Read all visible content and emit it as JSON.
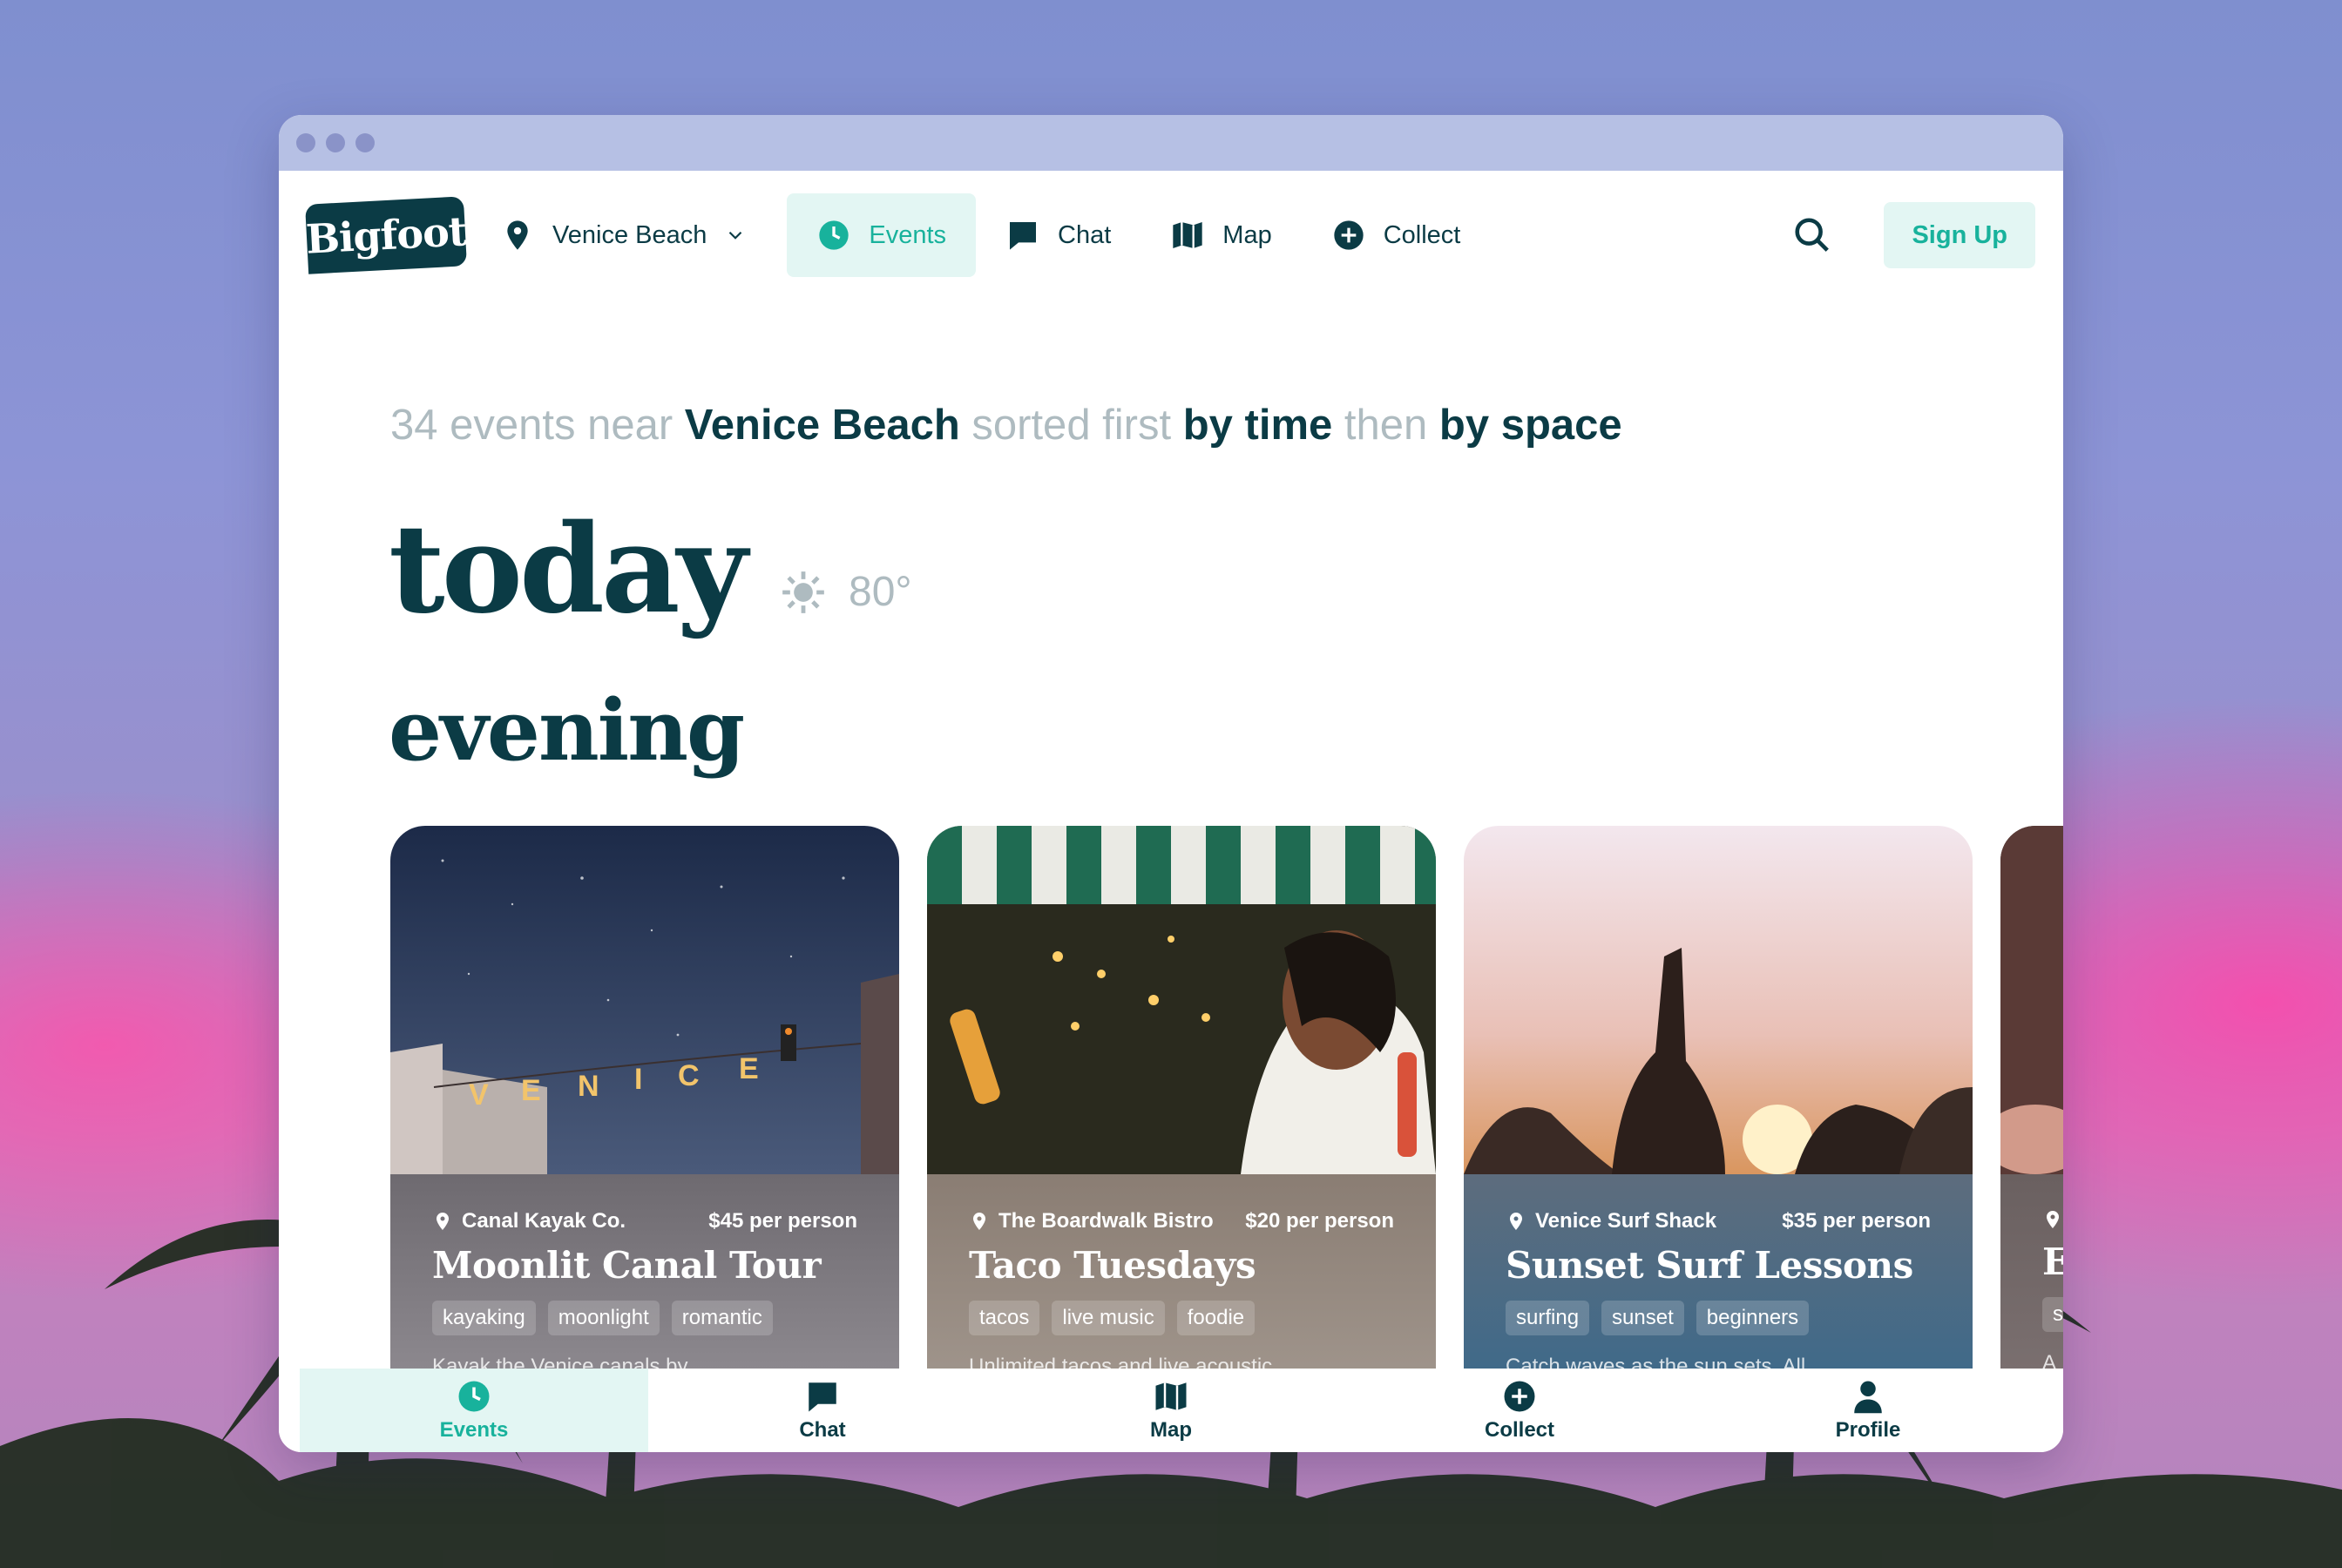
{
  "colors": {
    "brand_dark": "#0b3b45",
    "accent_teal": "#18b29c",
    "accent_bg": "#e3f6f3",
    "muted_text": "#aebbc0"
  },
  "brand": {
    "logo_text": "Bigfoot"
  },
  "top_nav": {
    "location": {
      "label": "Venice Beach",
      "icon": "map-pin-icon"
    },
    "items": [
      {
        "label": "Events",
        "icon": "clock-icon",
        "active": true
      },
      {
        "label": "Chat",
        "icon": "chat-bubble-icon",
        "active": false
      },
      {
        "label": "Map",
        "icon": "map-icon",
        "active": false
      },
      {
        "label": "Collect",
        "icon": "plus-circle-icon",
        "active": false
      }
    ],
    "search_icon": "search-icon",
    "signup_label": "Sign Up"
  },
  "headline": {
    "part1": "34 events near ",
    "place": "Venice Beach",
    "part2": " sorted first ",
    "sort1": "by time",
    "part3": " then ",
    "sort2": "by space"
  },
  "day": {
    "label": "today",
    "weather_icon": "sun-icon",
    "temperature": "80°"
  },
  "section": {
    "label": "evening"
  },
  "events": [
    {
      "venue": "Canal Kayak Co.",
      "price": "$45 per person",
      "title": "Moonlit Canal Tour",
      "tags": [
        "kayaking",
        "moonlight",
        "romantic"
      ],
      "description": "Kayak the Venice canals by",
      "photo": "night sky over Venice sign"
    },
    {
      "venue": "The Boardwalk Bistro",
      "price": "$20 per person",
      "title": "Taco Tuesdays",
      "tags": [
        "tacos",
        "live music",
        "foodie"
      ],
      "description": "Unlimited tacos and live acoustic",
      "photo": "woman laughing with drink under striped awning"
    },
    {
      "venue": "Venice Surf Shack",
      "price": "$35 per person",
      "title": "Sunset Surf Lessons",
      "tags": [
        "surfing",
        "sunset",
        "beginners"
      ],
      "description": "Catch waves as the sun sets. All",
      "photo": "people raising hands at sunset"
    },
    {
      "venue": "",
      "price": "",
      "title": "E",
      "tags": [
        "s"
      ],
      "description": "A",
      "photo": "partially visible card"
    }
  ],
  "bottom_nav": {
    "items": [
      {
        "label": "Events",
        "icon": "clock-icon",
        "active": true
      },
      {
        "label": "Chat",
        "icon": "chat-bubble-icon",
        "active": false
      },
      {
        "label": "Map",
        "icon": "map-icon",
        "active": false
      },
      {
        "label": "Collect",
        "icon": "plus-circle-icon",
        "active": false
      },
      {
        "label": "Profile",
        "icon": "person-icon",
        "active": false
      }
    ]
  }
}
